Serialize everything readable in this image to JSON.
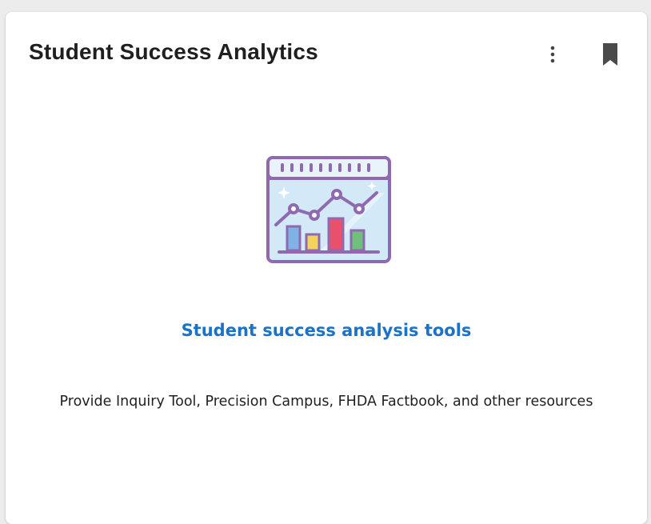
{
  "card": {
    "title": "Student Success Analytics",
    "link_title": "Student success analysis tools",
    "description": "Provide Inquiry Tool, Precision Campus, FHDA Factbook, and other resources",
    "icons": {
      "menu": "more-vertical-icon",
      "bookmark": "bookmark-icon",
      "illustration": "analytics-chart-icon"
    },
    "colors": {
      "link": "#1a73c8",
      "illustration_frame": "#8f6ab0",
      "illustration_fill": "#cfe6f7"
    }
  }
}
